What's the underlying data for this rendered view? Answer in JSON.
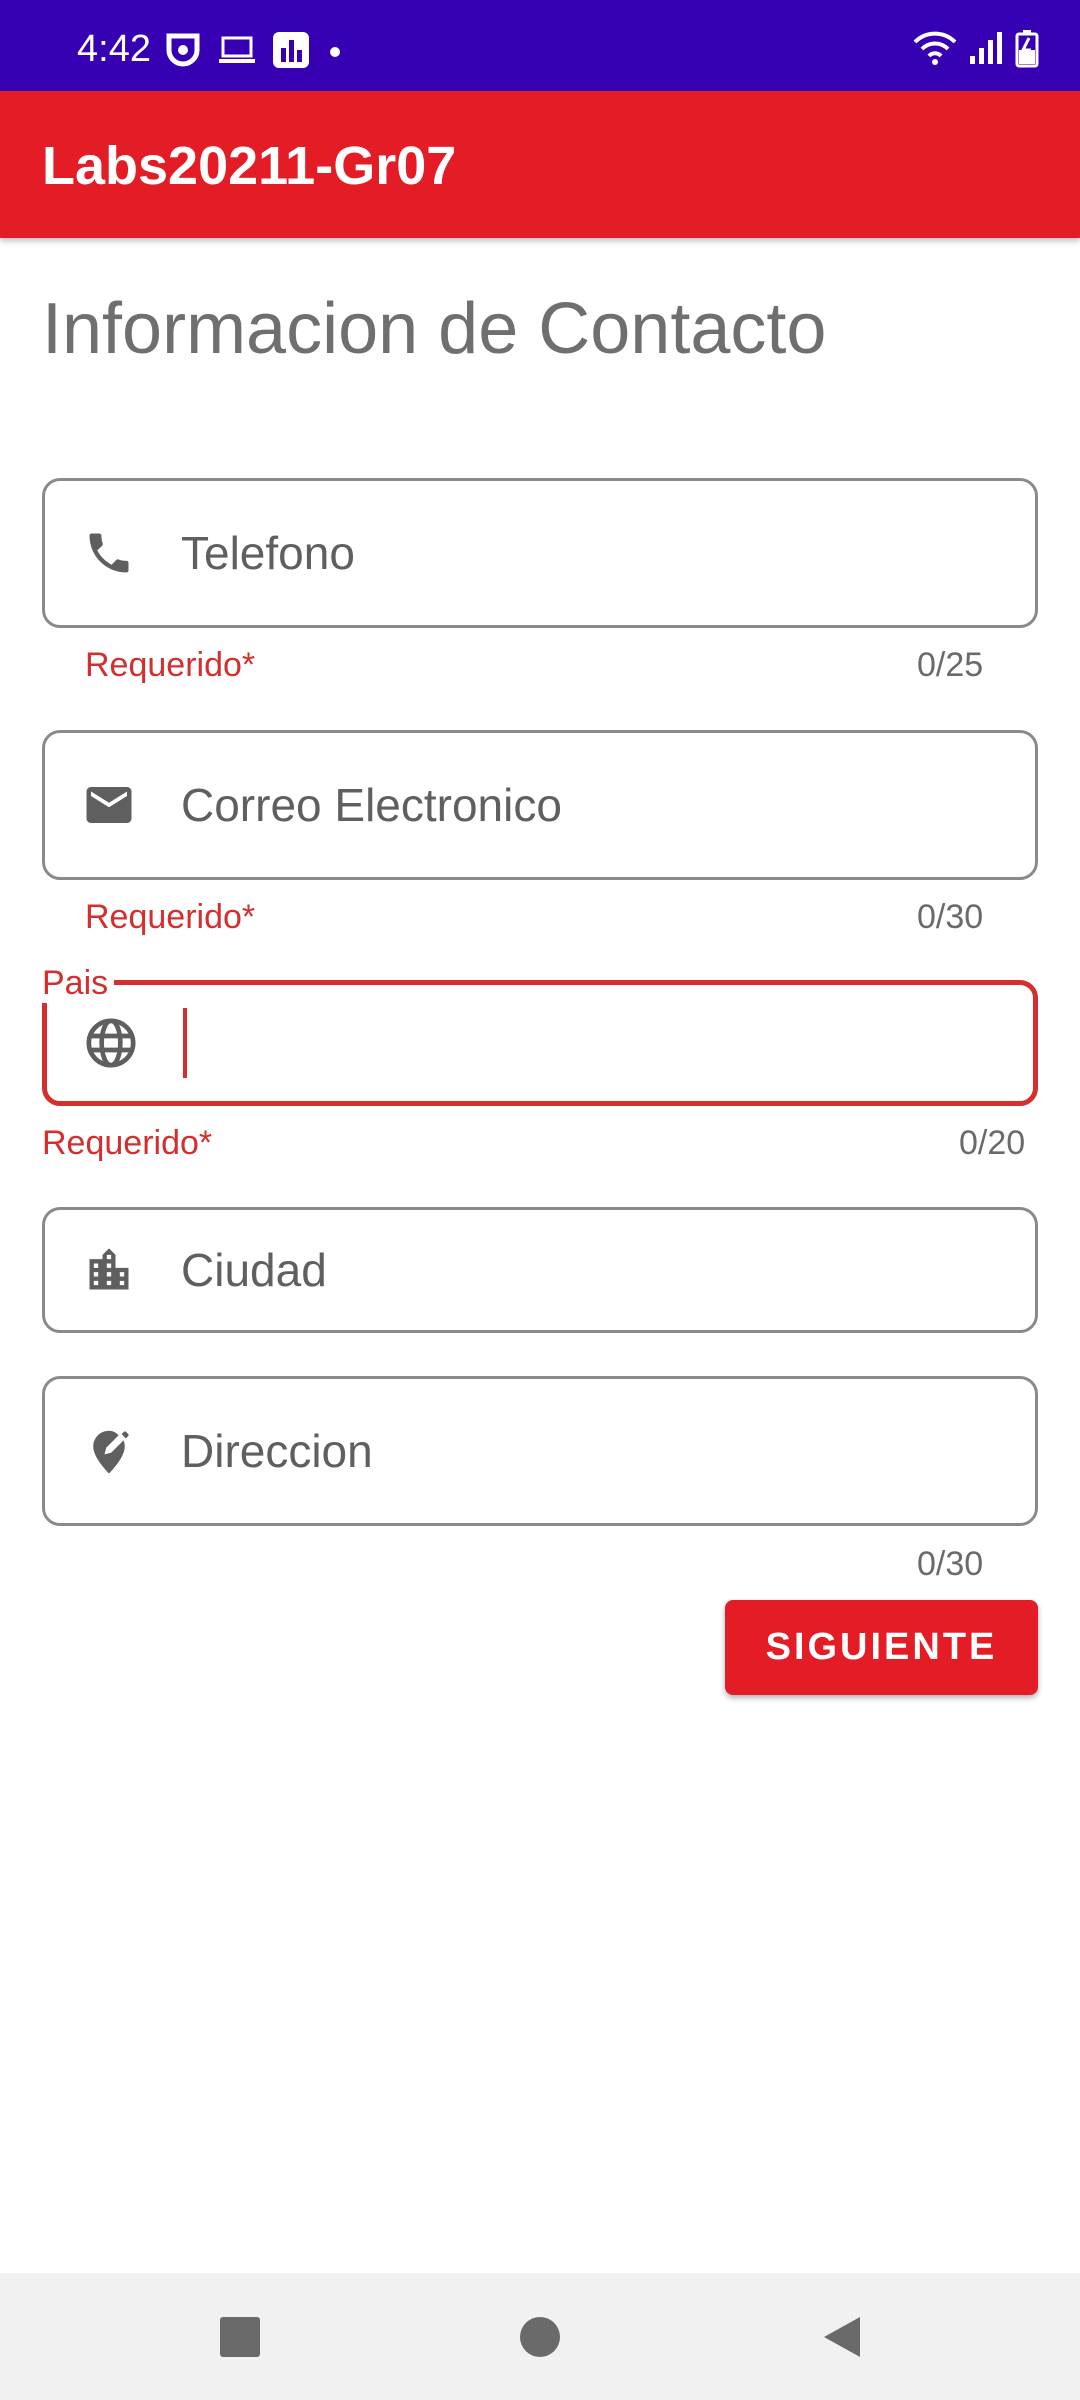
{
  "status_bar": {
    "time": "4:42",
    "left_icons": [
      "ring-icon",
      "laptop-icon",
      "stats-icon",
      "dot-icon"
    ],
    "right_icons": [
      "wifi-icon",
      "signal-icon",
      "battery-icon"
    ]
  },
  "app_bar": {
    "title": "Labs20211-Gr07",
    "color": "#e31c25"
  },
  "page": {
    "title": "Informacion de Contacto"
  },
  "form": {
    "telefono": {
      "placeholder": "Telefono",
      "helper": "Requerido*",
      "counter": "0/25",
      "icon": "phone-icon"
    },
    "correo": {
      "placeholder": "Correo Electronico",
      "helper": "Requerido*",
      "counter": "0/30",
      "icon": "mail-icon"
    },
    "pais": {
      "label": "Pais",
      "value": "",
      "helper": "Requerido*",
      "counter": "0/20",
      "icon": "globe-icon",
      "state": "focused-error"
    },
    "ciudad": {
      "placeholder": "Ciudad",
      "icon": "city-icon"
    },
    "direccion": {
      "placeholder": "Direccion",
      "counter": "0/30",
      "icon": "edit-location-icon"
    }
  },
  "actions": {
    "next_label": "SIGUIENTE"
  },
  "colors": {
    "status_bar": "#3700b3",
    "accent": "#e31c25",
    "error": "#d32f2f"
  }
}
